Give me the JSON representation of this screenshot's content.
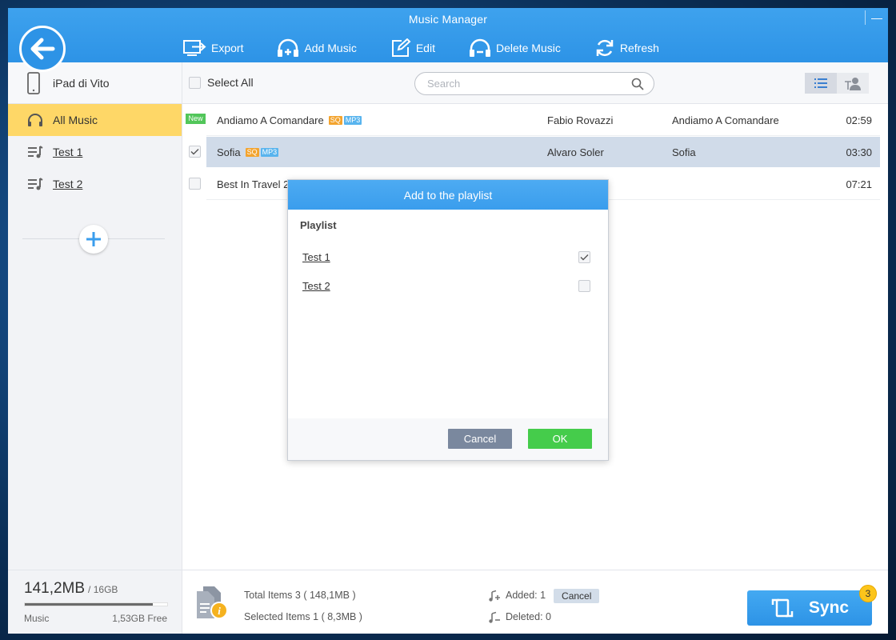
{
  "window": {
    "title": "Music Manager"
  },
  "window_controls": {
    "minimize": "—"
  },
  "toolbar": {
    "export": "Export",
    "add_music": "Add Music",
    "edit": "Edit",
    "delete_music": "Delete Music",
    "refresh": "Refresh"
  },
  "sidebar": {
    "device": "iPad di Vito",
    "items": [
      {
        "label": "All Music",
        "icon": "headphones-icon",
        "active": true
      },
      {
        "label": "Test 1",
        "icon": "playlist-icon"
      },
      {
        "label": "Test 2",
        "icon": "playlist-icon"
      }
    ]
  },
  "list": {
    "select_all": "Select All",
    "search_placeholder": "Search",
    "rows": [
      {
        "tag": "New",
        "title": "Andiamo A Comandare",
        "badges": [
          "SQ",
          "MP3"
        ],
        "artist": "Fabio Rovazzi",
        "album": "Andiamo A Comandare",
        "duration": "02:59",
        "checked": false,
        "selected": false
      },
      {
        "tag": "",
        "title": "Sofia",
        "badges": [
          "SQ",
          "MP3"
        ],
        "artist": "Alvaro Soler",
        "album": "Sofia",
        "duration": "03:30",
        "checked": true,
        "selected": true
      },
      {
        "tag": "",
        "title": "Best In Travel 20",
        "badges": [],
        "artist": "",
        "album": "",
        "duration": "07:21",
        "checked": false,
        "selected": false
      }
    ]
  },
  "storage": {
    "used": "141,2MB",
    "total": "/ 16GB",
    "fill_fraction": 0.9,
    "label": "Music",
    "free": "1,53GB Free"
  },
  "summary": {
    "total": "Total Items 3 ( 148,1MB )",
    "selected": "Selected Items 1 ( 8,3MB )"
  },
  "changes": {
    "added": "Added: 1",
    "deleted": "Deleted: 0",
    "cancel": "Cancel"
  },
  "sync": {
    "label": "Sync",
    "count": "3"
  },
  "dialog": {
    "title": "Add to the playlist",
    "section": "Playlist",
    "options": [
      {
        "label": "Test 1",
        "checked": true
      },
      {
        "label": "Test 2",
        "checked": false
      }
    ],
    "cancel": "Cancel",
    "ok": "OK"
  },
  "colors": {
    "header": "#2d93e6",
    "active_item": "#fed767",
    "selected_row": "#d0dbe9",
    "ok_button": "#45cc4b",
    "cancel_button": "#7a889e",
    "sync_badge": "#fcc51b"
  }
}
